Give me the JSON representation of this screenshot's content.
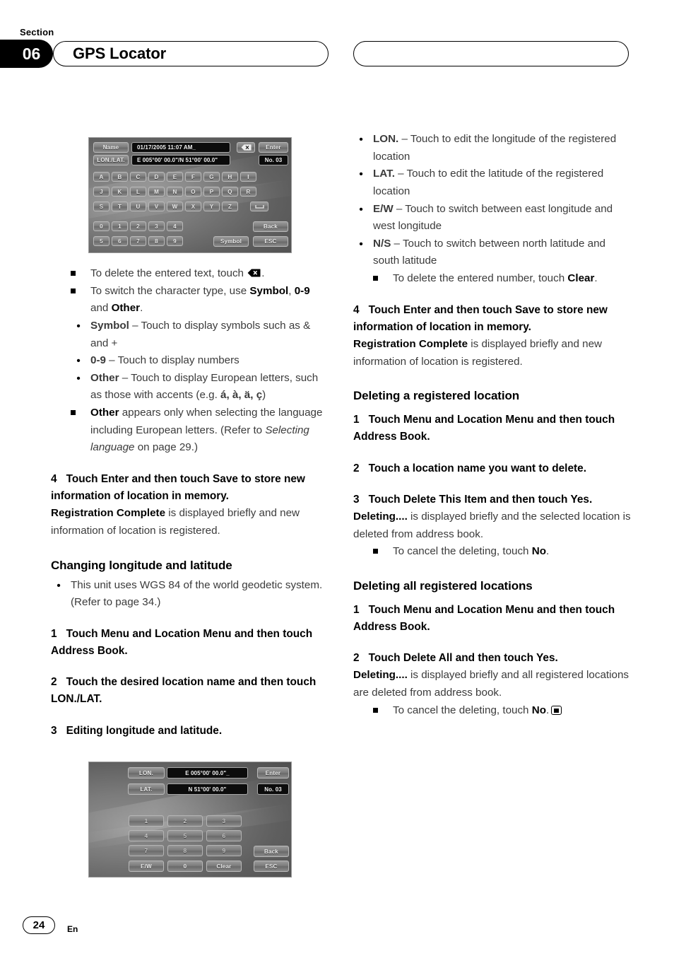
{
  "header": {
    "section_label": "Section",
    "section_number": "06",
    "title": "GPS Locator"
  },
  "footer": {
    "page_number": "24",
    "language": "En"
  },
  "device_screen_1": {
    "name_label": "Name",
    "name_value": "01/17/2005 11:07 AM_",
    "lonlat_label": "LON./LAT.",
    "lonlat_value": "E 005°00' 00.0\"/N 51°00' 00.0\"",
    "enter": "Enter",
    "number": "No. 03",
    "backspace_icon": "backspace-icon",
    "row1": [
      "A",
      "B",
      "C",
      "D",
      "E",
      "F",
      "G",
      "H",
      "I"
    ],
    "row2": [
      "J",
      "K",
      "L",
      "M",
      "N",
      "O",
      "P",
      "Q",
      "R"
    ],
    "row3": [
      "S",
      "T",
      "U",
      "V",
      "W",
      "X",
      "Y",
      "Z"
    ],
    "space_icon": "space-bar-icon",
    "row4": [
      "0",
      "1",
      "2",
      "3",
      "4"
    ],
    "row5": [
      "5",
      "6",
      "7",
      "8",
      "9"
    ],
    "symbol": "Symbol",
    "back": "Back",
    "esc": "ESC"
  },
  "device_screen_2": {
    "lon_label": "LON.",
    "lon_value": "E 005°00' 00.0\"_",
    "lat_label": "LAT.",
    "lat_value": "N  51°00' 00.0\"",
    "enter": "Enter",
    "number": "No. 03",
    "keys": [
      "1",
      "2",
      "3",
      "4",
      "5",
      "6",
      "7",
      "8",
      "9"
    ],
    "ew": "E/W",
    "zero": "0",
    "clear": "Clear",
    "back": "Back",
    "esc": "ESC"
  },
  "left_column": {
    "note_delete_text_pre": "To delete the entered text, touch ",
    "note_delete_text_post": ".",
    "note_switch_pre": "To switch the character type, use ",
    "note_switch_b1": "Symbol",
    "note_switch_mid": ", ",
    "note_switch_b2": "0-9",
    "note_switch_mid2": " and ",
    "note_switch_b3": "Other",
    "note_switch_post": ".",
    "bullet_symbol_b": "Symbol",
    "bullet_symbol_t": " – Touch to display symbols such as & and +",
    "bullet_09_b": "0-9",
    "bullet_09_t": " – Touch to display numbers",
    "bullet_other_b": "Other",
    "bullet_other_t": " – Touch to display European letters, such as those with accents (e.g. ",
    "bullet_other_accents": "á, à, ä, ç",
    "bullet_other_close": ")",
    "note_other_b": "Other",
    "note_other_t1": " appears only when selecting the language including European letters. (Refer to ",
    "note_other_it": "Selecting language",
    "note_other_t2": " on page 29.)",
    "step4_num": "4",
    "step4_text": "Touch Enter and then touch Save to store new information of location in memory.",
    "step4_body_b": "Registration Complete",
    "step4_body_t": " is displayed briefly and new information of location is registered.",
    "subhead_changing": "Changing longitude and latitude",
    "bullet_wgs": "This unit uses WGS 84 of the world geodetic system. (Refer to page 34.)",
    "step1_num": "1",
    "step1_text": "Touch Menu and Location Menu and then touch Address Book.",
    "step2_num": "2",
    "step2_text": "Touch the desired location name and then touch LON./LAT.",
    "step3_num": "3",
    "step3_text": "Editing longitude and latitude."
  },
  "right_column": {
    "bullet_lon_b": "LON.",
    "bullet_lon_t": " – Touch to edit the longitude of the registered location",
    "bullet_lat_b": "LAT.",
    "bullet_lat_t": " – Touch to edit the latitude of the registered location",
    "bullet_ew_b": "E/W",
    "bullet_ew_t": " – Touch to switch between east longitude and west longitude",
    "bullet_ns_b": "N/S",
    "bullet_ns_t": " – Touch to switch between north latitude and south latitude",
    "note_clear_pre": "To delete the entered number, touch ",
    "note_clear_b": "Clear",
    "note_clear_post": ".",
    "step4_num": "4",
    "step4_text": "Touch Enter and then touch Save to store new information of location in memory.",
    "step4_body_b": "Registration Complete",
    "step4_body_t": " is displayed briefly and new information of location is registered.",
    "subhead_deleting_one": "Deleting a registered location",
    "d1_num": "1",
    "d1_text": "Touch Menu and Location Menu and then touch Address Book.",
    "d2_num": "2",
    "d2_text": "Touch a location name you want to delete.",
    "d3_num": "3",
    "d3_text": "Touch Delete This Item and then touch Yes.",
    "d3_body_b": "Deleting....",
    "d3_body_t": " is displayed briefly and the selected location is deleted from address book.",
    "d3_note_pre": "To cancel the deleting, touch ",
    "d3_note_b": "No",
    "d3_note_post": ".",
    "subhead_deleting_all": "Deleting all registered locations",
    "a1_num": "1",
    "a1_text": "Touch Menu and Location Menu and then touch Address Book.",
    "a2_num": "2",
    "a2_text": "Touch Delete All and then touch Yes.",
    "a2_body_b": "Deleting....",
    "a2_body_t": " is displayed briefly and all registered locations are deleted from address book.",
    "a2_note_pre": "To cancel the deleting, touch ",
    "a2_note_b": "No",
    "a2_note_post": "."
  }
}
